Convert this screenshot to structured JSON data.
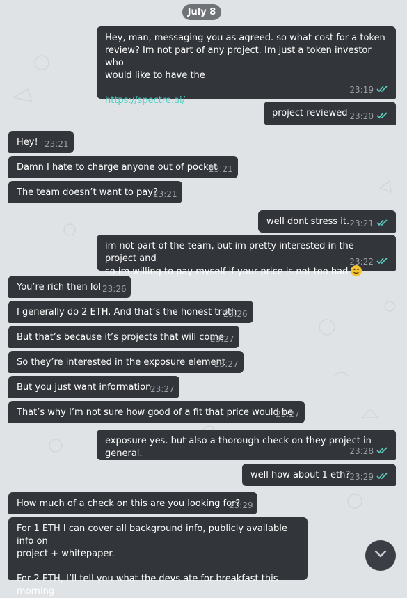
{
  "date": "July 8",
  "messages": [
    {
      "dir": "out",
      "lines": [
        "Hey, man, messaging you as agreed. so what cost for a token",
        "review? Im not part of any project. Im just a token investor who",
        "would like to have the"
      ],
      "link": "https://spectre.ai/",
      "time": "23:19"
    },
    {
      "dir": "out",
      "text": "project reviewed",
      "time": "23:20"
    },
    {
      "dir": "in",
      "text": "Hey!",
      "time": "23:21"
    },
    {
      "dir": "in",
      "text": "Damn I hate to charge anyone out of pocket",
      "time": "23:21"
    },
    {
      "dir": "in",
      "text": "The team doesn’t want to pay?",
      "time": "23:21"
    },
    {
      "dir": "out",
      "text": "well dont stress it.",
      "time": "23:21"
    },
    {
      "dir": "out",
      "lines": [
        "im not part of the team, but im pretty interested in the project and",
        "so im willing to pay myself if your price is not too bad"
      ],
      "emoji": "winking-face",
      "time": "23:22"
    },
    {
      "dir": "in",
      "text": "You’re rich then lol",
      "time": "23:26"
    },
    {
      "dir": "in",
      "text": "I generally do 2 ETH. And that’s the honest truth",
      "time": "23:26"
    },
    {
      "dir": "in",
      "text": "But that’s because it’s projects that will come",
      "time": "23:27"
    },
    {
      "dir": "in",
      "text": "So they’re interested in the exposure element",
      "time": "23:27"
    },
    {
      "dir": "in",
      "text": "But you just want information",
      "time": "23:27"
    },
    {
      "dir": "in",
      "text": "That’s why I’m not sure how good of a fit that price would be",
      "time": "23:27"
    },
    {
      "dir": "out",
      "text": "exposure yes. but also a thorough check on they project in general.",
      "time": "23:28"
    },
    {
      "dir": "out",
      "text": "well how about 1 eth?",
      "time": "23:29"
    },
    {
      "dir": "in",
      "text": "How much of a check on this are you looking for?",
      "time": "23:29"
    },
    {
      "dir": "in",
      "lines": [
        "For 1 ETH I can cover all background info, publicly available info on",
        "project + whitepaper.",
        "",
        "For 2 ETH, I’ll tell you what the devs ate for breakfast this morning"
      ]
    }
  ],
  "icons": {
    "read_status": "double-check-icon",
    "scroll_down": "chevron-down-icon",
    "check_color": "#5fd3c6",
    "bubble_color": "#32353a",
    "background_color": "#dfe3e6"
  }
}
